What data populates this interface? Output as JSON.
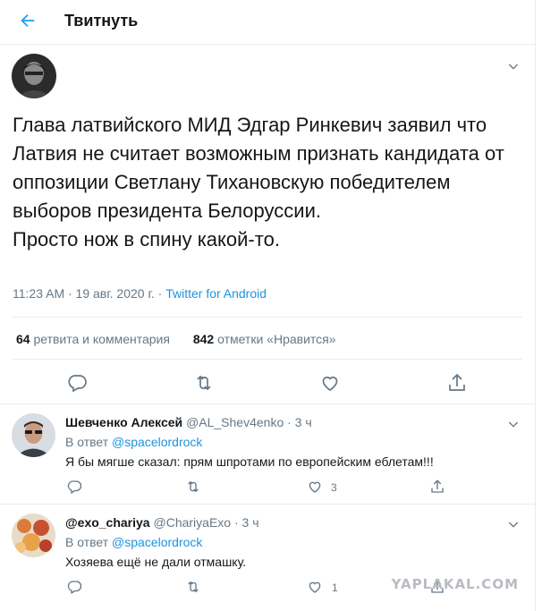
{
  "header": {
    "title": "Твитнуть"
  },
  "tweet": {
    "text": "Глава латвийского МИД Эдгар Ринкевич заявил что Латвия не считает возможным признать кандидата от оппозиции Светлану Тихановскую победителем выборов президента Белоруссии.\nПросто нож в спину какой-то.",
    "time": "11:23 AM · 19 авг. 2020 г.",
    "separator": " · ",
    "app": "Twitter for Android",
    "retweets_count": "64",
    "retweets_label": "ретвита и комментария",
    "likes_count": "842",
    "likes_label": "отметки «Нравится»"
  },
  "replies": [
    {
      "name": "Шевченко Алексей",
      "handle": "@AL_Shev4enko",
      "time": "· 3 ч",
      "reply_to_label": "В ответ",
      "reply_to_mention": "@spacelordrock",
      "text": "Я бы мягше сказал: прям шпротами по европейским еблетам!!!",
      "likes": "3"
    },
    {
      "name": "@exo_chariya",
      "handle": "@ChariyaExo",
      "time": "· 3 ч",
      "reply_to_label": "В ответ",
      "reply_to_mention": "@spacelordrock",
      "text": "Хозяева ещё не дали отмашку.",
      "likes": "1"
    }
  ],
  "watermark": "YAPLAKAL.COM",
  "colors": {
    "accent": "#1da1f2",
    "link": "#1b95e0",
    "muted": "#657786",
    "border": "#e6ecf0"
  },
  "icons": [
    "back-arrow-icon",
    "chevron-down-icon",
    "reply-icon",
    "retweet-icon",
    "like-icon",
    "share-icon"
  ]
}
